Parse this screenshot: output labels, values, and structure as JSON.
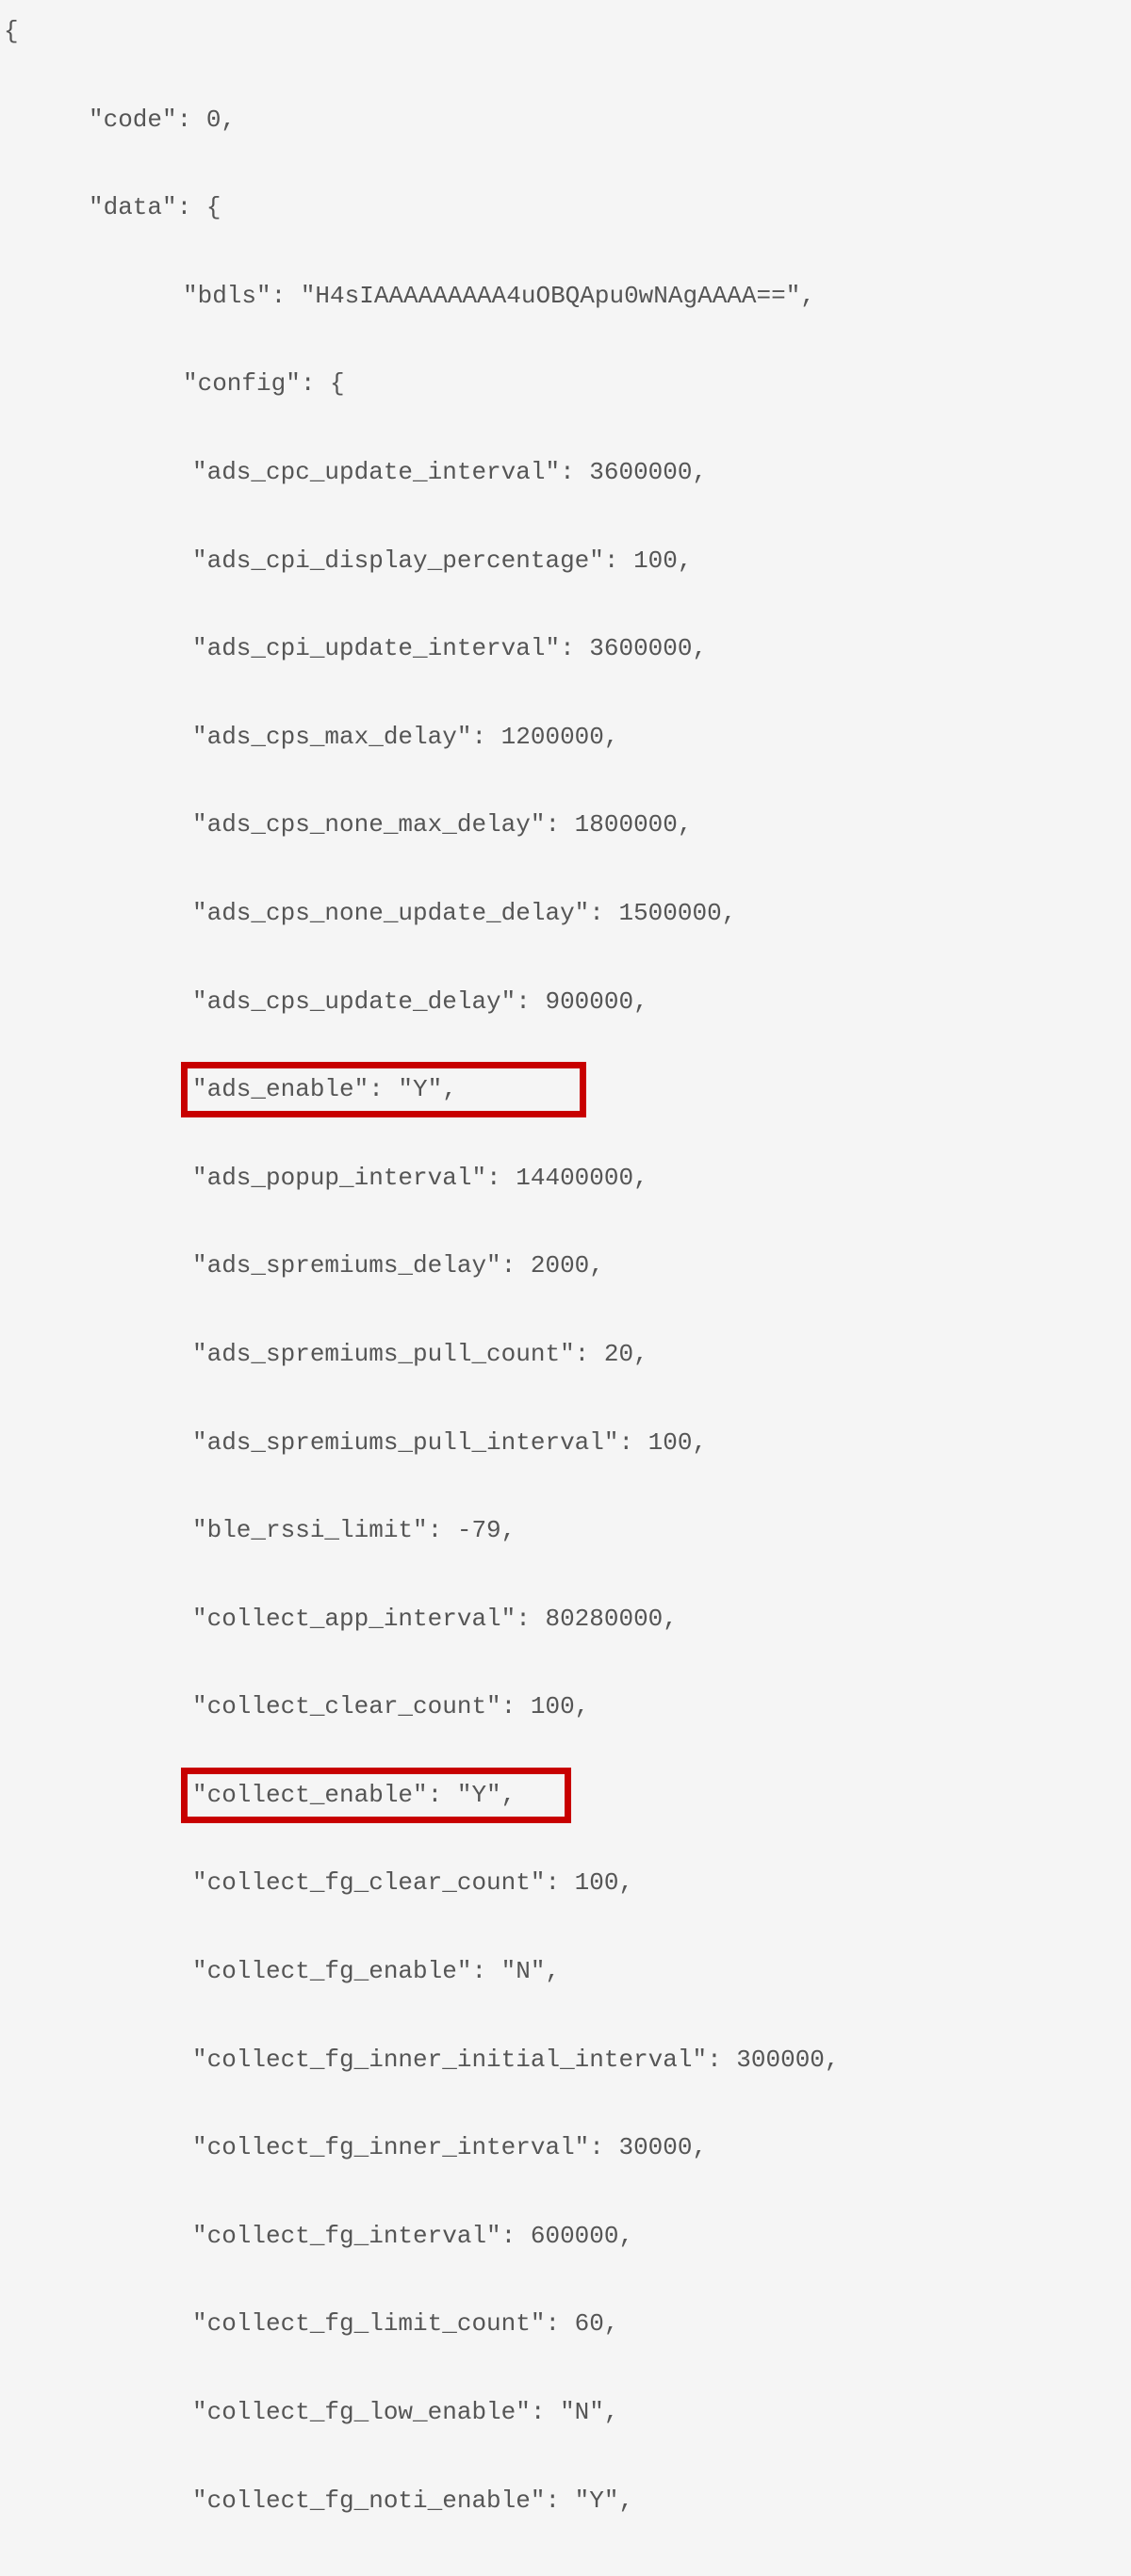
{
  "lines": {
    "l00": "{",
    "l01": "\"code\": 0,",
    "l02": "\"data\": {",
    "l03": "\"bdls\": \"H4sIAAAAAAAAA4uOBQApu0wNAgAAAA==\",",
    "l04": "\"config\": {",
    "l05": "\"ads_cpc_update_interval\": 3600000,",
    "l06": "\"ads_cpi_display_percentage\": 100,",
    "l07": "\"ads_cpi_update_interval\": 3600000,",
    "l08": "\"ads_cps_max_delay\": 1200000,",
    "l09": "\"ads_cps_none_max_delay\": 1800000,",
    "l10": "\"ads_cps_none_update_delay\": 1500000,",
    "l11": "\"ads_cps_update_delay\": 900000,",
    "l12": "\"ads_enable\": \"Y\",",
    "l13": "\"ads_popup_interval\": 14400000,",
    "l14": "\"ads_spremiums_delay\": 2000,",
    "l15": "\"ads_spremiums_pull_count\": 20,",
    "l16": "\"ads_spremiums_pull_interval\": 100,",
    "l17": "\"ble_rssi_limit\": -79,",
    "l18": "\"collect_app_interval\": 80280000,",
    "l19": "\"collect_clear_count\": 100,",
    "l20": "\"collect_enable\": \"Y\",",
    "l21": "\"collect_fg_clear_count\": 100,",
    "l22": "\"collect_fg_enable\": \"N\",",
    "l23": "\"collect_fg_inner_initial_interval\": 300000,",
    "l24": "\"collect_fg_inner_interval\": 30000,",
    "l25": "\"collect_fg_interval\": 600000,",
    "l26": "\"collect_fg_limit_count\": 60,",
    "l27": "\"collect_fg_low_enable\": \"N\",",
    "l28": "\"collect_fg_noti_enable\": \"Y\","
  },
  "highlight_color": "#c80000"
}
